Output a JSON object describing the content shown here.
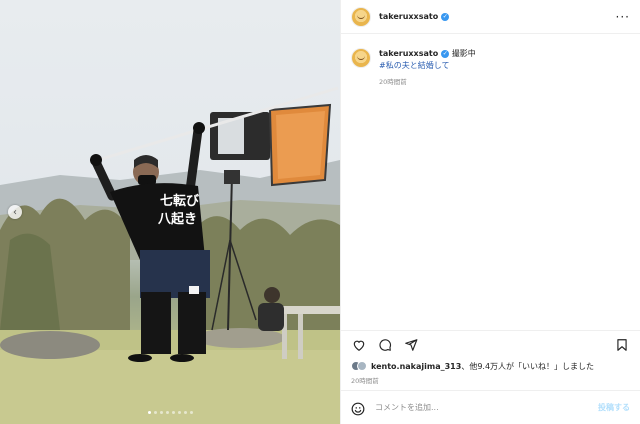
{
  "photo": {
    "shirt_text": "七転び八起き",
    "prev_icon": "chevron-left-icon",
    "dot_count": 8,
    "active_dot": 0
  },
  "post": {
    "username": "takeruxxsato",
    "verified": true,
    "more_icon": "more-horizontal-icon"
  },
  "caption": {
    "username": "takeruxxsato",
    "text": "撮影中",
    "hashtag": "#私の夫と結婚して",
    "time": "20時間前"
  },
  "actions": {
    "like_icon": "heart-icon",
    "comment_icon": "comment-icon",
    "share_icon": "send-icon",
    "save_icon": "bookmark-icon"
  },
  "likes": {
    "user": "kento.nakajima_313",
    "rest": "、他9.4万人が「いいね！」しました"
  },
  "post_time": "20時間前",
  "comment_box": {
    "emoji_icon": "smiley-icon",
    "placeholder": "コメントを追加...",
    "post_label": "投稿する"
  },
  "colors": {
    "accent_link": "#2a5db0",
    "verified_badge": "#3897f0",
    "post_button_disabled": "#b2dffc"
  }
}
